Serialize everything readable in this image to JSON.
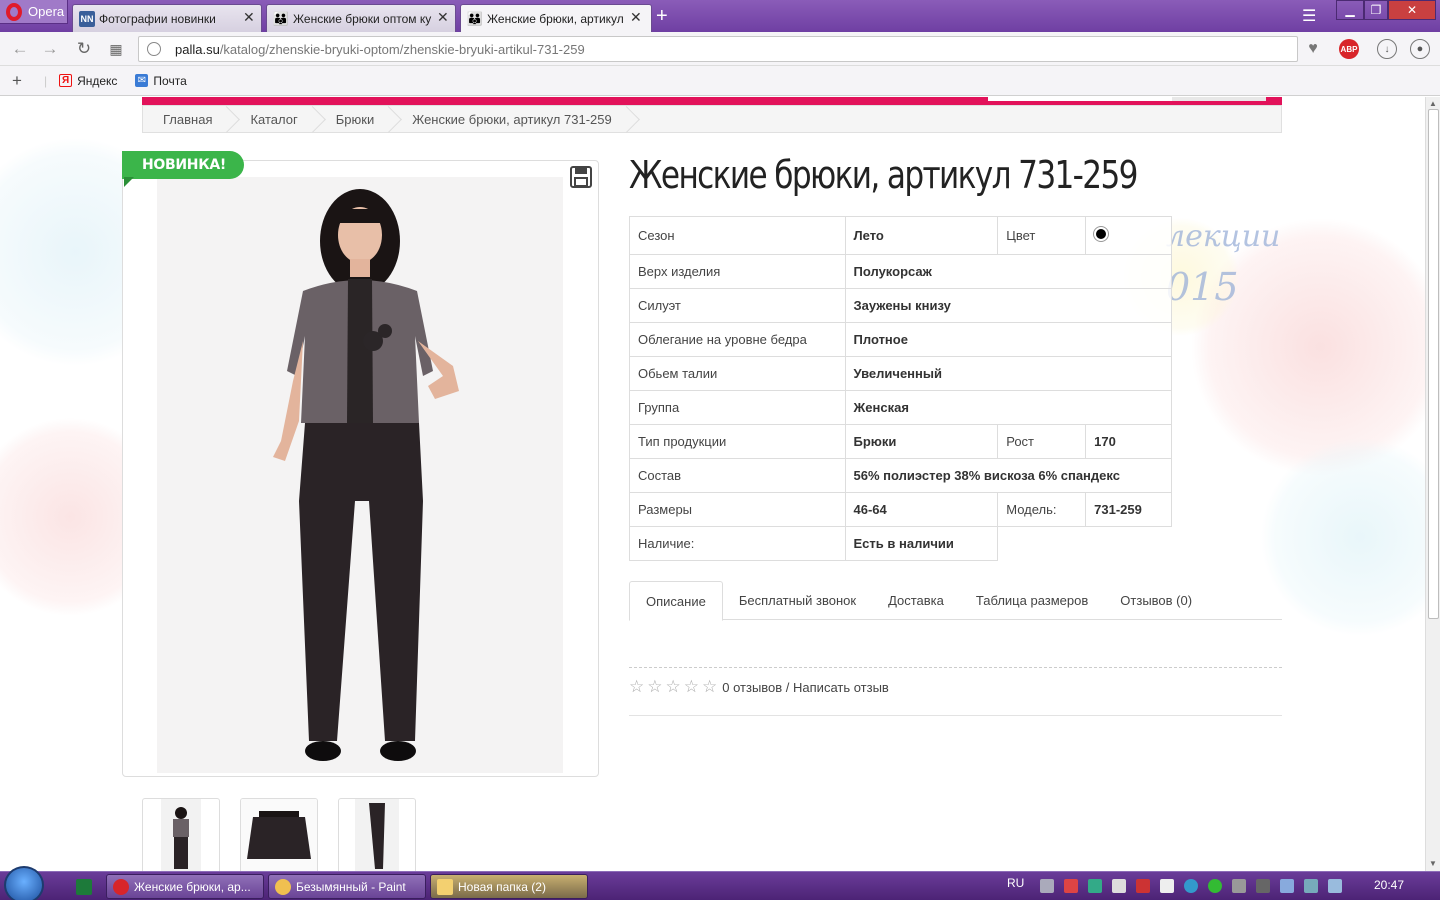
{
  "browser": {
    "menu_label": "Opera",
    "tabs": [
      {
        "title": "Фотографии новинки",
        "favicon": "NN"
      },
      {
        "title": "Женские брюки оптом ку",
        "favicon": "people-icon"
      },
      {
        "title": "Женские брюки, артикул",
        "favicon": "people-icon",
        "active": true
      }
    ],
    "address": {
      "host": "palla.su",
      "path": "/katalog/zhenskie-bryuki-optom/zhenskie-bryuki-artikul-731-259"
    },
    "abp_label": "ABP",
    "bookmarks": [
      {
        "label": "Яндекс",
        "icon": "yandex-icon"
      },
      {
        "label": "Почта",
        "icon": "mail-icon"
      }
    ]
  },
  "page": {
    "breadcrumbs": [
      "Главная",
      "Каталог",
      "Брюки",
      "Женские брюки, артикул 731-259"
    ],
    "badge": "НОВИНКА!",
    "title": "Женские брюки, артикул 731-259",
    "watermark": [
      "лекции",
      "015"
    ],
    "attributes": {
      "season_label": "Сезон",
      "season_value": "Лето",
      "color_label": "Цвет",
      "color_value": "#000000",
      "top_label": "Верх изделия",
      "top_value": "Полукорсаж",
      "silhouette_label": "Силуэт",
      "silhouette_value": "Заужены книзу",
      "hip_label": "Облегание на уровне бедра",
      "hip_value": "Плотное",
      "waist_label": "Обьем талии",
      "waist_value": "Увеличенный",
      "group_label": "Группа",
      "group_value": "Женская",
      "type_label": "Тип продукции",
      "type_value": "Брюки",
      "height_label": "Рост",
      "height_value": "170",
      "composition_label": "Состав",
      "composition_value": "56% полиэстер 38% вискоза 6% спандекс",
      "sizes_label": "Размеры",
      "sizes_value": "46-64",
      "model_label": "Модель:",
      "model_value": "731-259",
      "availability_label": "Наличие:",
      "availability_value": "Есть в наличии"
    },
    "tabs": [
      "Описание",
      "Бесплатный звонок",
      "Доставка",
      "Таблица размеров",
      "Отзывов (0)"
    ],
    "reviews_text": "0 отзывов / Написать отзыв",
    "rating": 0
  },
  "taskbar": {
    "tasks": [
      "Женские брюки, ар...",
      "Безымянный - Paint",
      "Новая папка (2)"
    ],
    "lang": "RU",
    "time": "20:47"
  }
}
